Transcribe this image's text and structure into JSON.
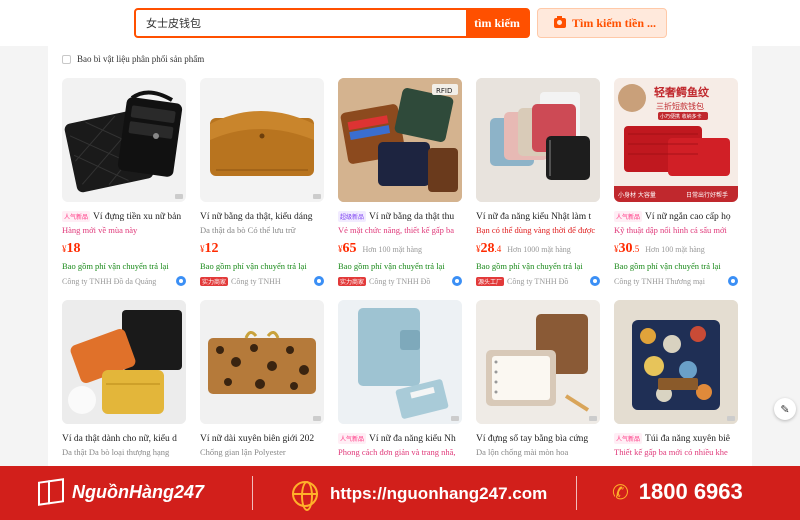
{
  "search": {
    "query": "女士皮钱包",
    "button_label": "tìm kiếm",
    "image_search_label": "Tìm kiếm tiền ..."
  },
  "filter": {
    "checkbox_label": "Bao bì vật liệu phân phối sản phẩm"
  },
  "products": [
    {
      "badge": "人气新品",
      "title": "Ví đựng tiền xu nữ bản",
      "title_highlight": "nữ",
      "tagline": "Hàng mới về mùa này",
      "tagline_color": "pink",
      "currency": "¥",
      "price_int": "18",
      "price_dec": "",
      "sold": "",
      "shipping": "Bao gồm phí vận chuyển trả lại",
      "shop_badge": "",
      "shop": "Công ty TNHH Đồ da Quảng",
      "chat_icon": true
    },
    {
      "badge": "",
      "title": "Ví nữ bằng da thật, kiểu dáng",
      "tagline": "Da thật da bò Có thể lưu trữ",
      "tagline_color": "grey",
      "currency": "¥",
      "price_int": "12",
      "price_dec": "",
      "sold": "",
      "shipping": "Bao gồm phí vận chuyển trả lại",
      "shop_badge": "实力商家",
      "shop": "Công ty TNHH",
      "chat_icon": true
    },
    {
      "badge": "超级新品",
      "title": "Ví nữ bằng da thật thu",
      "tagline": "Vẻ mặt chức năng, thiết kế gấp ba",
      "tagline_color": "pink",
      "currency": "¥",
      "price_int": "65",
      "price_dec": "",
      "sold": "Hơn 100 mặt hàng",
      "shipping": "Bao gồm phí vận chuyển trả lại",
      "shop_badge": "实力商家",
      "shop": "Công ty TNHH Đồ",
      "chat_icon": true
    },
    {
      "badge": "",
      "title": "Ví nữ đa năng kiểu Nhật làm t",
      "tagline": "Bạn có thể dùng vàng thời để được",
      "tagline_color": "red",
      "currency": "¥",
      "price_int": "28",
      "price_dec": ".4",
      "sold": "Hơn 1000 mặt hàng",
      "shipping": "Bao gồm phí vận chuyển trả lại",
      "shop_badge": "源头工厂",
      "shop": "Công ty TNHH Đồ",
      "chat_icon": true
    },
    {
      "badge": "人气新品",
      "title": "Ví nữ ngắn cao cấp họ",
      "tagline": "Kỹ thuật dập nổi hình cá sấu mới",
      "tagline_color": "pink",
      "currency": "¥",
      "price_int": "30",
      "price_dec": ".5",
      "sold": "Hơn 100 mặt hàng",
      "shipping": "Bao gồm phí vận chuyển trả lại",
      "shop_badge": "",
      "shop": "Công ty TNHH Thương mại",
      "chat_icon": true
    },
    {
      "badge": "",
      "title": "Ví da thật dành cho nữ, kiểu d",
      "tagline": "Da thật Da bò loại thượng hạng",
      "tagline_color": "grey"
    },
    {
      "badge": "",
      "title": "Ví nữ dài xuyên biên giới 202",
      "title_prefix_red": "Ví nữ",
      "tagline": "Chống gian lận Polyester",
      "tagline_color": "grey"
    },
    {
      "badge": "人气新品",
      "title": "Ví nữ đa năng kiểu Nh",
      "tagline": "Phong cách đơn giản và trang nhã,",
      "tagline_color": "pink"
    },
    {
      "badge": "",
      "title": "Ví đựng sổ tay bằng bìa cứng",
      "tagline": "Da lộn chống mài mòn hoa",
      "tagline_color": "grey"
    },
    {
      "badge": "人气新品",
      "title": "Túi đa năng xuyên biê",
      "tagline": "Thiết kế gấp ba mới có nhiều khe",
      "tagline_color": "pink"
    }
  ],
  "thumb_texts": {
    "p3_tag": "RFID",
    "p5_line1": "轻奢鳄鱼纹",
    "p5_line2": "三折短款钱包",
    "p5_line3": "小巧便携 收纳多卡",
    "p5_foot_left": "小身材 大容量",
    "p5_foot_right": "日常出行好帮手"
  },
  "banner": {
    "brand": "NguồnHàng247",
    "website": "https://nguonhang247.com",
    "phone": "1800 6963"
  },
  "colors": {
    "accent": "#ff5000",
    "price": "#ff2a00",
    "shipping_green": "#1a8a1a",
    "banner_red": "#d21f1b"
  },
  "icons": {
    "camera": "camera-icon",
    "chat": "chat-icon",
    "edit": "pencil-icon",
    "globe": "globe-icon",
    "phone": "phone-icon",
    "box": "box-icon"
  }
}
